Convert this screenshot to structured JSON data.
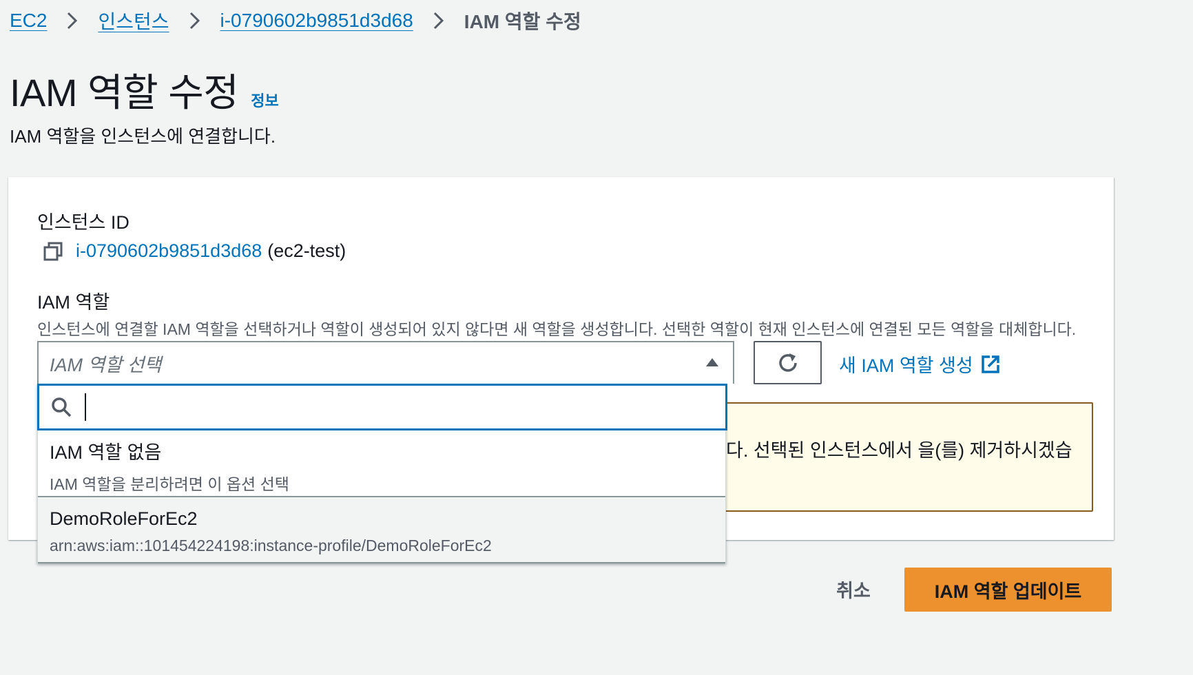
{
  "breadcrumb": {
    "items": [
      "EC2",
      "인스턴스",
      "i-0790602b9851d3d68"
    ],
    "current": "IAM 역할 수정"
  },
  "page": {
    "title": "IAM 역할 수정",
    "info": "정보",
    "description": "IAM 역할을 인스턴스에 연결합니다."
  },
  "form": {
    "instance_id_label": "인스턴스 ID",
    "instance_id": "i-0790602b9851d3d68",
    "instance_name": "(ec2-test)",
    "role_label": "IAM 역할",
    "role_description": "인스턴스에 연결할 IAM 역할을 선택하거나 역할이 생성되어 있지 않다면 새 역할을 생성합니다. 선택한 역할이 현재 인스턴스에 연결된 모든 역할을 대체합니다.",
    "select_placeholder": "IAM 역할 선택",
    "create_role_link": "새 IAM 역할 생성",
    "warning_text": "다. 선택된 인스턴스에서 을(를) 제거하시겠습"
  },
  "dropdown": {
    "search_value": "",
    "options": [
      {
        "title": "IAM 역할 없음",
        "subtitle": "IAM 역할을 분리하려면 이 옵션 선택"
      },
      {
        "title": "DemoRoleForEc2",
        "subtitle": "arn:aws:iam::101454224198:instance-profile/DemoRoleForEc2"
      }
    ]
  },
  "actions": {
    "cancel": "취소",
    "submit": "IAM 역할 업데이트"
  },
  "colors": {
    "link": "#0073bb",
    "primary_button": "#ec912d",
    "warning_bg": "#fffce9",
    "warning_border": "#8a5a1f",
    "focus_border": "#0073bb"
  }
}
